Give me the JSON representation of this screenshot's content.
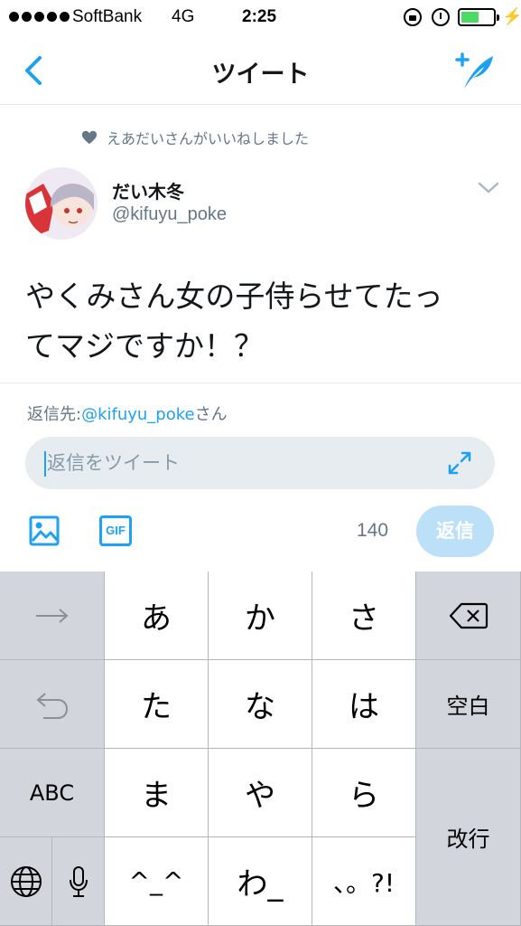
{
  "status_bar": {
    "carrier": "SoftBank",
    "network": "4G",
    "time": "2:25",
    "battery_level": 0.55,
    "bolt": "⚡"
  },
  "nav": {
    "title": "ツイート",
    "back_icon": "chevron-left-icon",
    "compose_icon": "compose-feather-icon"
  },
  "colors": {
    "accent": "#1da1f2",
    "muted": "#657786",
    "reply_button_disabled": "#bde0f9",
    "keyboard_bg": "#c9cdd3"
  },
  "liked_banner": "えあだいさんがいいねしました",
  "tweet": {
    "author_name": "だい木冬",
    "author_handle": "@kifuyu_poke",
    "text_line1": "やくみさん女の子侍らせてたっ",
    "text_line2": "てマジですか！？"
  },
  "reply": {
    "prefix": "返信先:",
    "mention": "@kifuyu_poke",
    "suffix": "さん",
    "placeholder": "返信をツイート",
    "value": "",
    "gif_label": "GIF",
    "char_count": "140",
    "button_label": "返信"
  },
  "keyboard": {
    "row1": [
      "あ",
      "か",
      "さ"
    ],
    "row2": [
      "た",
      "な",
      "は"
    ],
    "row3": [
      "ま",
      "や",
      "ら"
    ],
    "row4": [
      "^_^",
      "わ_",
      "、。?!"
    ],
    "abc": "ABC",
    "space": "空白",
    "return": "改行"
  }
}
